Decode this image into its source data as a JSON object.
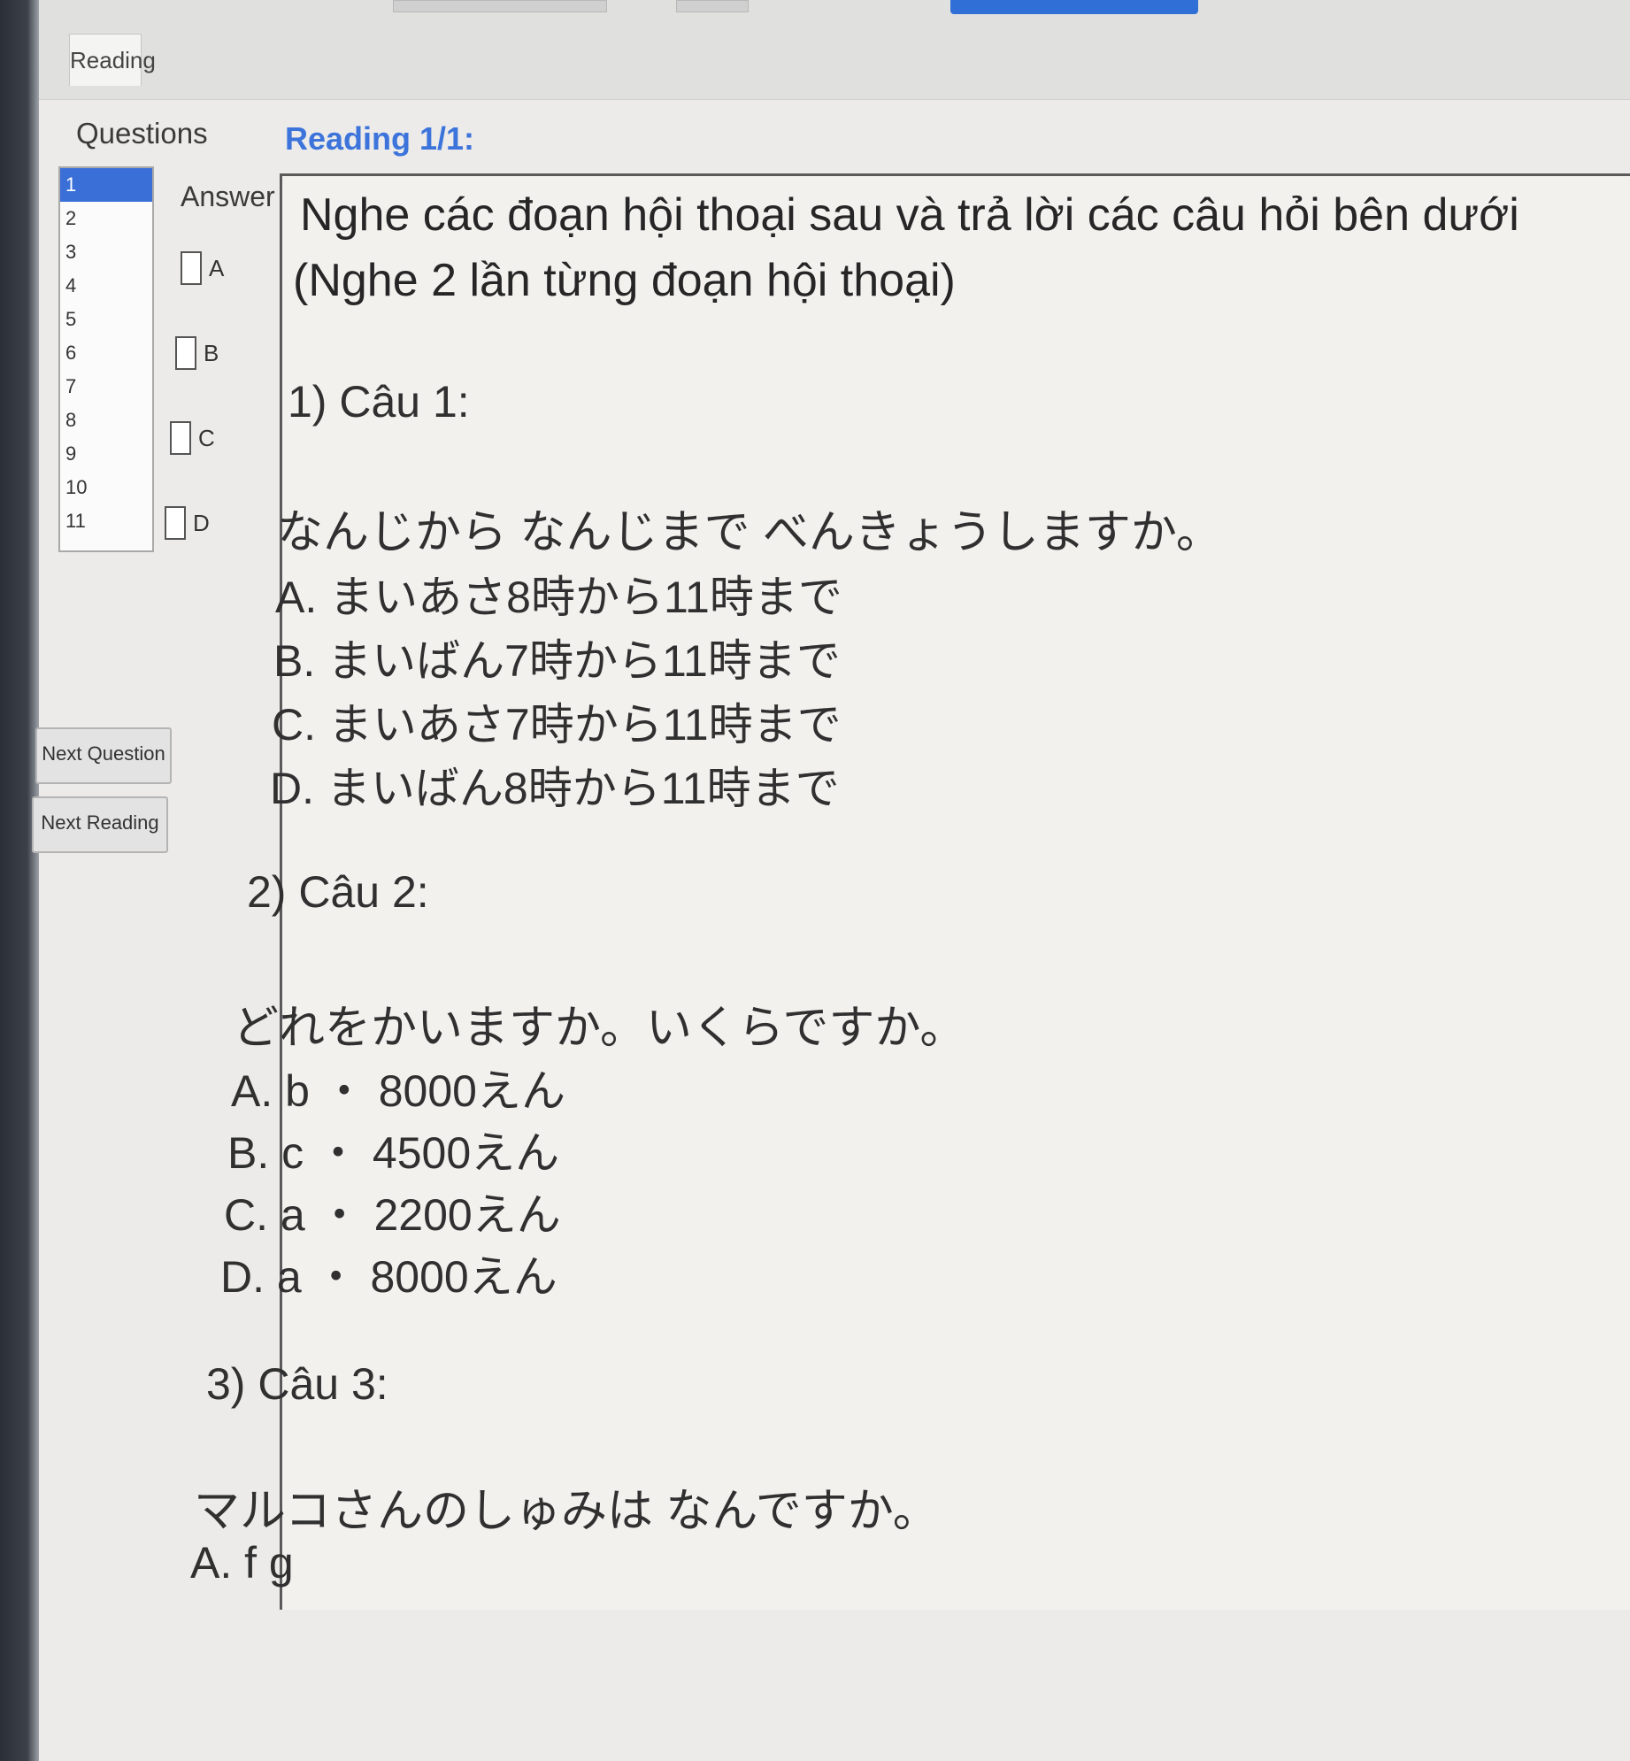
{
  "tab": {
    "label": "Reading"
  },
  "sidebar": {
    "questions_label": "Questions",
    "question_numbers": [
      "1",
      "2",
      "3",
      "4",
      "5",
      "6",
      "7",
      "8",
      "9",
      "10",
      "11"
    ],
    "selected_index": 0,
    "answer_label": "Answer",
    "options": [
      "A",
      "B",
      "C",
      "D"
    ],
    "next_question": "Next Question",
    "next_reading": "Next Reading"
  },
  "reading": {
    "title": "Reading 1/1:",
    "instruction_line1": "Nghe các đoạn hội thoại sau và trả lời các câu hỏi bên dưới",
    "instruction_line2": "(Nghe 2 lần từng đoạn hội thoại)",
    "questions": [
      {
        "heading": "1) Câu 1:",
        "prompt": "なんじから なんじまで べんきょうしますか。",
        "options": [
          "A. まいあさ8時から11時まで",
          "B. まいばん7時から11時まで",
          "C. まいあさ7時から11時まで",
          "D. まいばん8時から11時まで"
        ]
      },
      {
        "heading": "2) Câu 2:",
        "prompt": "どれをかいますか。いくらですか。",
        "options": [
          "A. b ・ 8000えん",
          "B. c ・ 4500えん",
          "C. a ・ 2200えん",
          "D. a ・ 8000えん"
        ]
      },
      {
        "heading": "3) Câu 3:",
        "prompt": "マルコさんのしゅみは なんですか。",
        "options": [
          "A. f g"
        ]
      }
    ]
  }
}
